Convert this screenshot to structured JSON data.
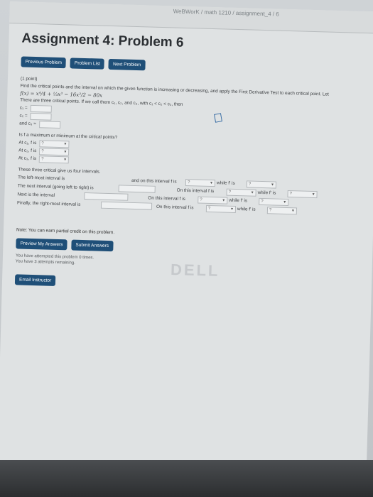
{
  "breadcrumb": "WeBWorK / math 1210 / assignment_4 / 6",
  "title": "Assignment 4: Problem 6",
  "nav": {
    "prev": "Previous Problem",
    "list": "Problem List",
    "next": "Next Problem"
  },
  "problem": {
    "points": "(1 point)",
    "intro": "Find the critical points and the interval on which the given function is increasing or decreasing, and apply the First Derivative Test to each critical point. Let",
    "function": "f(x) = x⁴/4 + ⅓x³ − 16x²/2 − 80x",
    "crit_text": "There are three critical points. If we call them c₁, c₂, and c₃, with c₁ < c₂ < c₃, then",
    "c1": "c₁ =",
    "c2": "c₂ =",
    "c3": "and c₃ =",
    "maxmin_q": "Is f a maximum or minimum at the critical points?",
    "at_c1": "At c₁, f is",
    "at_c2": "At c₂, f is",
    "at_c3": "At c₃, f is",
    "placeholder_sel": "?",
    "intervals_text": "These three critical give us four intervals.",
    "left_interval": "The left-most interval is",
    "on_this_interval": "and on this interval f is",
    "while_f_is": "while f' is",
    "next_interval": "The next interval (going left to right) is",
    "on_this_interval_short": "On this interval f is",
    "next_is": "Next is the interval",
    "finally": "Finally, the right-most interval is"
  },
  "note": "Note: You can earn partial credit on this problem.",
  "actions": {
    "preview": "Preview My Answers",
    "submit": "Submit Answers"
  },
  "attempts_1": "You have attempted this problem 0 times.",
  "attempts_2": "You have 3 attempts remaining.",
  "email": "Email Instructor",
  "bezel_brand": "DELL"
}
